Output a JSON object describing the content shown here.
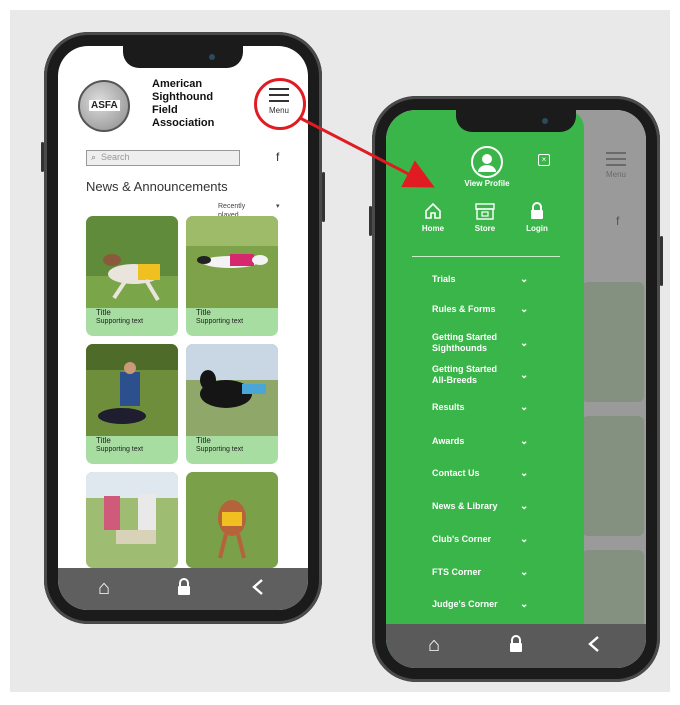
{
  "phone_a": {
    "org_logo_text": "ASFA",
    "org_name": [
      "American",
      "Sighthound",
      "Field",
      "Association"
    ],
    "menu_label": "Menu",
    "search_placeholder": "Search",
    "facebook_glyph": "f",
    "section_title": "News & Announcements",
    "sort_label": "Recently played",
    "cards": [
      {
        "title": "Title",
        "subtitle": "Supporting text"
      },
      {
        "title": "Title",
        "subtitle": "Supporting text"
      },
      {
        "title": "Title",
        "subtitle": "Supporting text"
      },
      {
        "title": "Title",
        "subtitle": "Supporting text"
      }
    ],
    "bottom_nav": [
      "home-icon",
      "lock-icon",
      "back-icon"
    ]
  },
  "phone_b": {
    "menu_label": "Menu",
    "facebook_glyph": "f",
    "profile_label": "View Profile",
    "close_glyph": "×",
    "quick_links": [
      {
        "label": "Home",
        "icon": "home-icon"
      },
      {
        "label": "Store",
        "icon": "store-icon"
      },
      {
        "label": "Login",
        "icon": "lock-icon"
      }
    ],
    "nav_items": [
      "Trials",
      "Rules & Forms",
      "Getting Started Sighthounds",
      "Getting Started All-Breeds",
      "Results",
      "Awards",
      "Contact Us",
      "News & Library",
      "Club's Corner",
      "FTS Corner",
      "Judge's Corner"
    ],
    "bottom_nav": [
      "home-icon",
      "lock-icon",
      "back-icon"
    ]
  },
  "colors": {
    "drawer_green": "#3ab54a",
    "card_green": "#a7dda0",
    "highlight_red": "#e11b22",
    "bottom_bar": "#5f5f5f"
  }
}
